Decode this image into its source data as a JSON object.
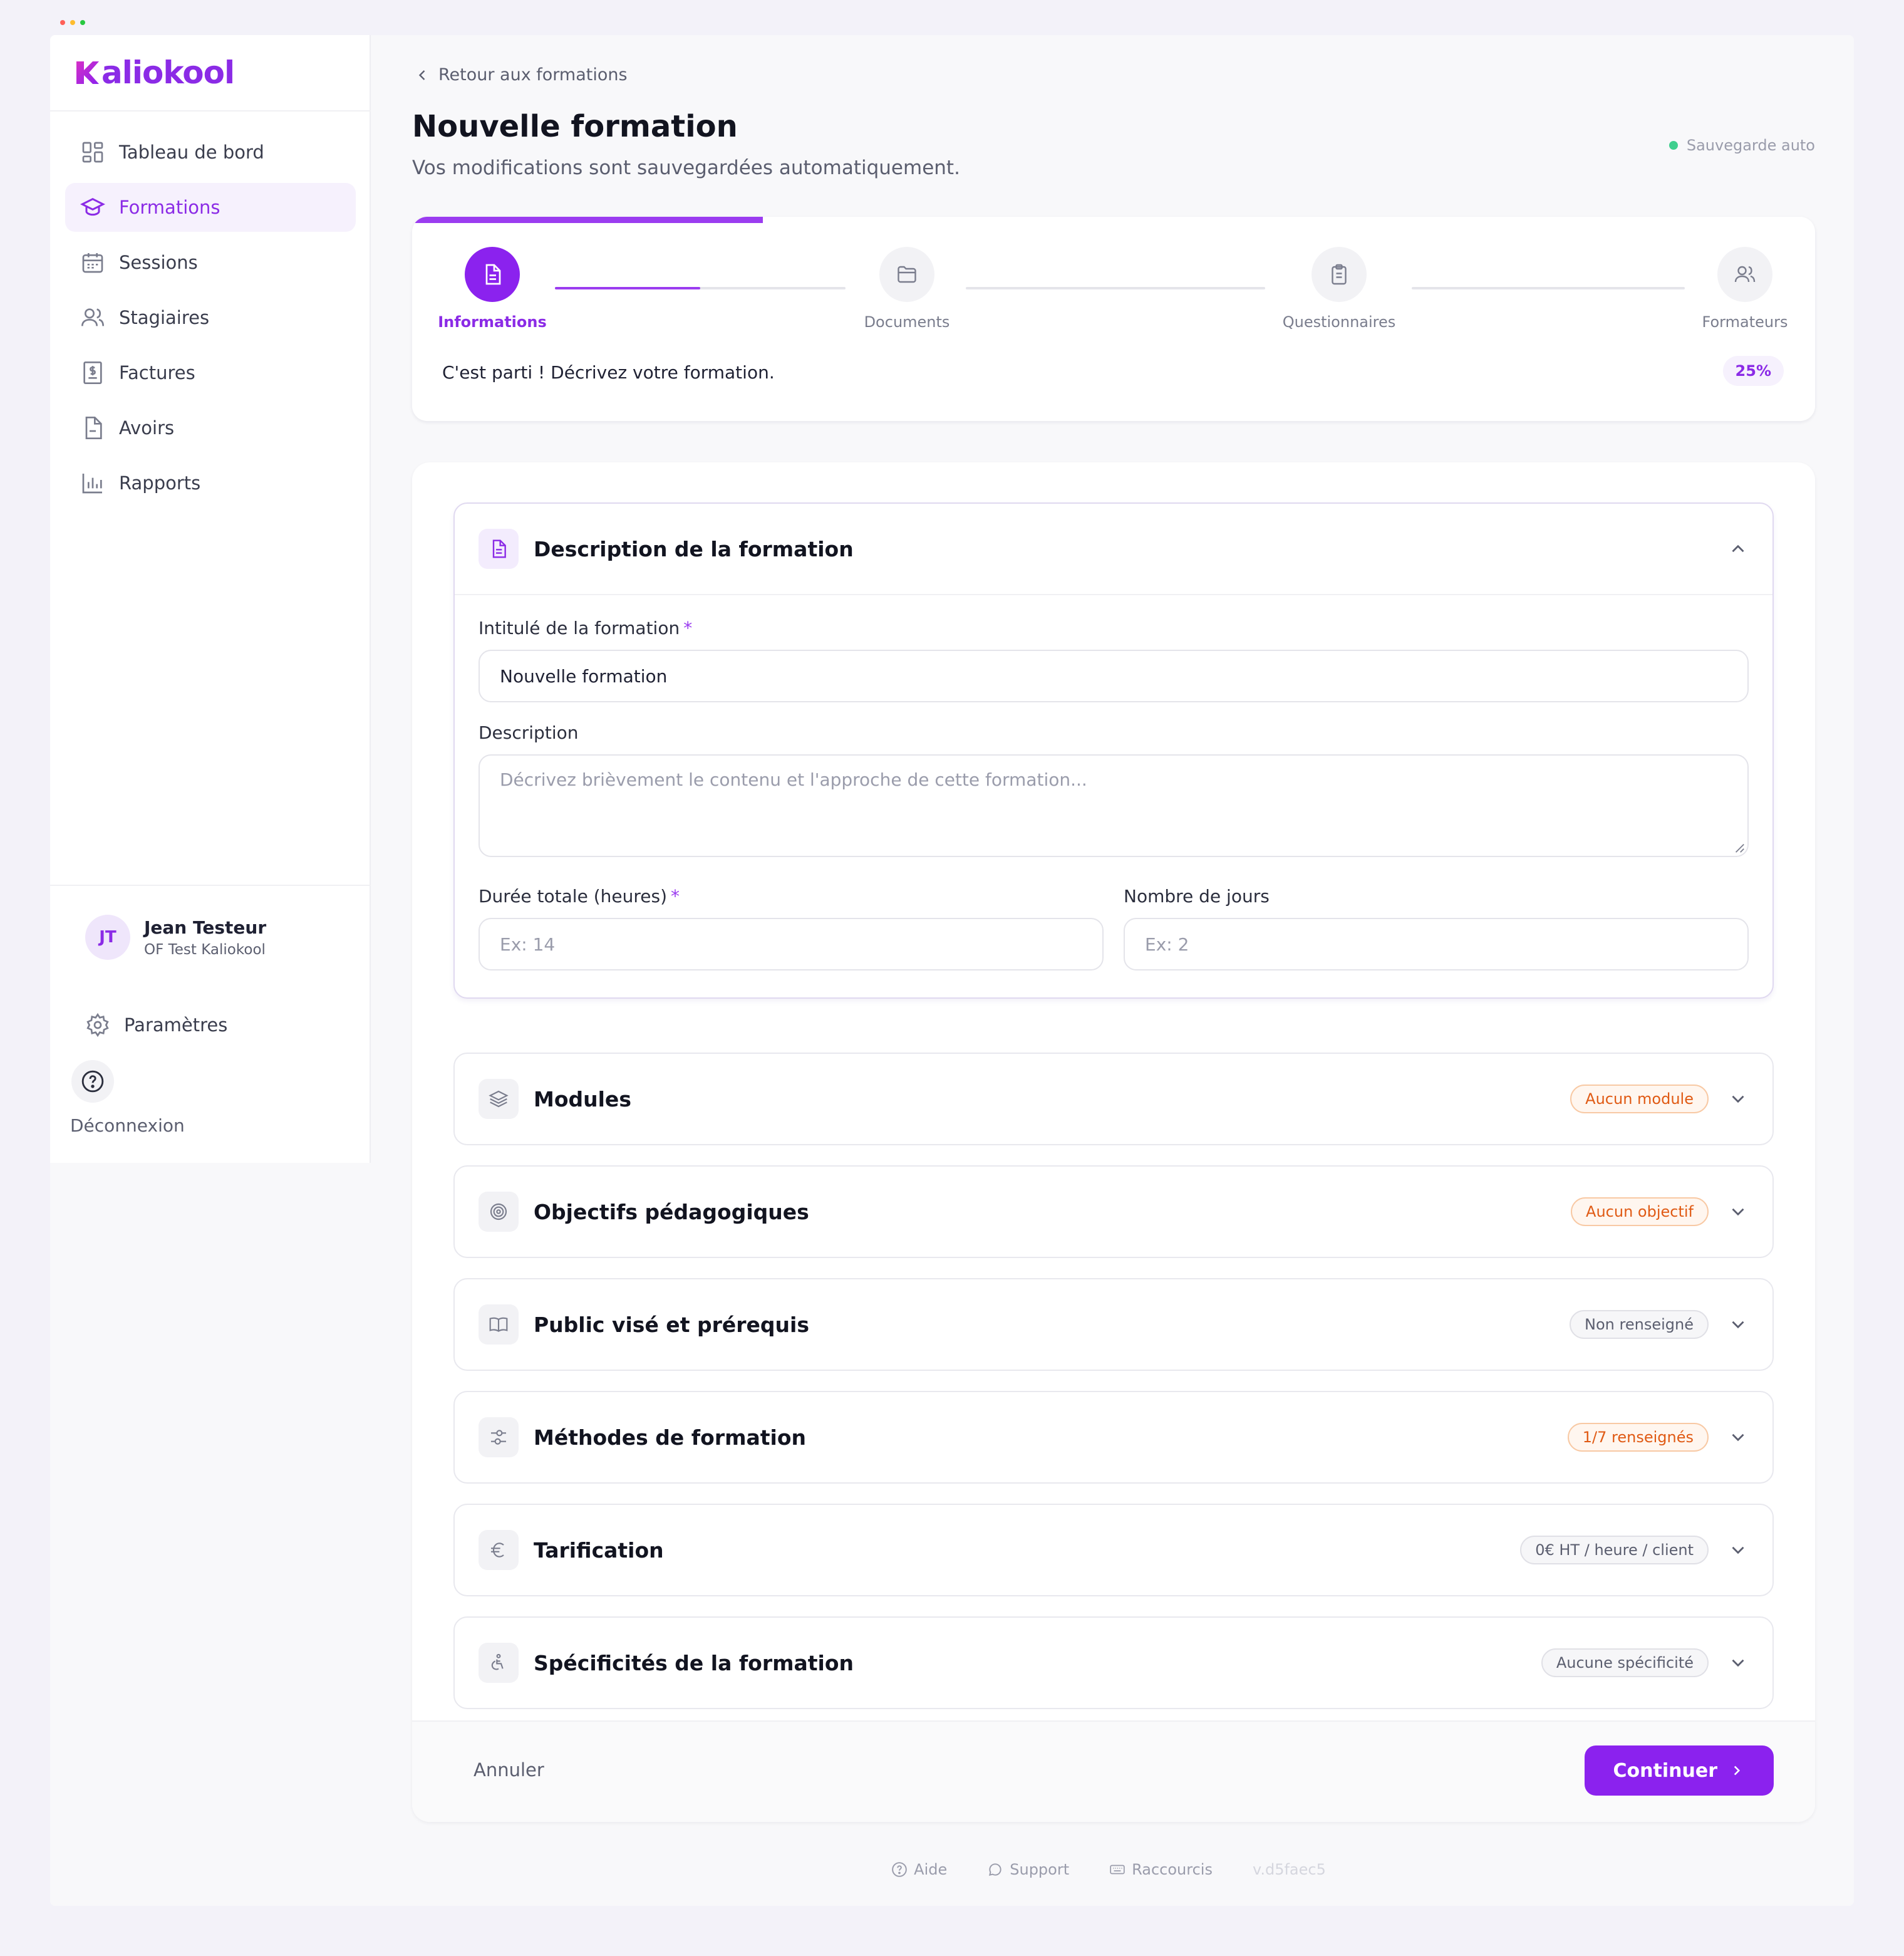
{
  "window": {
    "dot_colors": [
      "#ff5f57",
      "#febc2e",
      "#28c840"
    ]
  },
  "brand": {
    "name": "Kaliokool",
    "accent": "#8b22ee"
  },
  "sidebar": {
    "items": [
      {
        "label": "Tableau de bord",
        "icon": "dashboard-icon"
      },
      {
        "label": "Formations",
        "icon": "graduation-cap-icon",
        "active": true
      },
      {
        "label": "Sessions",
        "icon": "calendar-icon"
      },
      {
        "label": "Stagiaires",
        "icon": "users-icon"
      },
      {
        "label": "Factures",
        "icon": "invoice-icon"
      },
      {
        "label": "Avoirs",
        "icon": "file-icon"
      },
      {
        "label": "Rapports",
        "icon": "bar-chart-icon"
      }
    ],
    "user": {
      "initials": "JT",
      "name": "Jean Testeur",
      "org": "OF Test Kaliokool"
    },
    "settings_label": "Paramètres",
    "logout_label": "Déconnexion"
  },
  "header": {
    "back_label": "Retour aux formations",
    "title": "Nouvelle formation",
    "subtitle": "Vos modifications sont sauvegardées automatiquement.",
    "autosave_label": "Sauvegarde auto"
  },
  "stepper": {
    "progress": 0.25,
    "steps": [
      {
        "label": "Informations",
        "icon": "document-icon",
        "active": true
      },
      {
        "label": "Documents",
        "icon": "folder-icon"
      },
      {
        "label": "Questionnaires",
        "icon": "clipboard-icon"
      },
      {
        "label": "Formateurs",
        "icon": "users-icon"
      }
    ],
    "message": "C'est parti ! Décrivez votre formation.",
    "percent_label": "25%"
  },
  "form": {
    "description_section": {
      "title": "Description de la formation",
      "title_label": "Intitulé de la formation",
      "title_value": "Nouvelle formation",
      "description_label": "Description",
      "description_placeholder": "Décrivez brièvement le contenu et l'approche de cette formation...",
      "duration_label": "Durée totale (heures)",
      "duration_placeholder": "Ex: 14",
      "days_label": "Nombre de jours",
      "days_placeholder": "Ex: 2",
      "required_mark": "*"
    },
    "sections": [
      {
        "title": "Modules",
        "badge": "Aucun module",
        "badge_type": "warn",
        "icon": "layers-icon"
      },
      {
        "title": "Objectifs pédagogiques",
        "badge": "Aucun objectif",
        "badge_type": "warn",
        "icon": "target-icon"
      },
      {
        "title": "Public visé et prérequis",
        "badge": "Non renseigné",
        "badge_type": "neutral",
        "icon": "book-icon"
      },
      {
        "title": "Méthodes de formation",
        "badge": "1/7 renseignés",
        "badge_type": "warn",
        "icon": "sliders-icon"
      },
      {
        "title": "Tarification",
        "badge": "0€ HT / heure / client",
        "badge_type": "neutral",
        "icon": "euro-icon"
      },
      {
        "title": "Spécificités de la formation",
        "badge": "Aucune spécificité",
        "badge_type": "neutral",
        "icon": "accessibility-icon"
      }
    ],
    "cancel_label": "Annuler",
    "continue_label": "Continuer"
  },
  "footer": {
    "help_label": "Aide",
    "support_label": "Support",
    "shortcuts_label": "Raccourcis",
    "version": "v.d5faec5"
  }
}
